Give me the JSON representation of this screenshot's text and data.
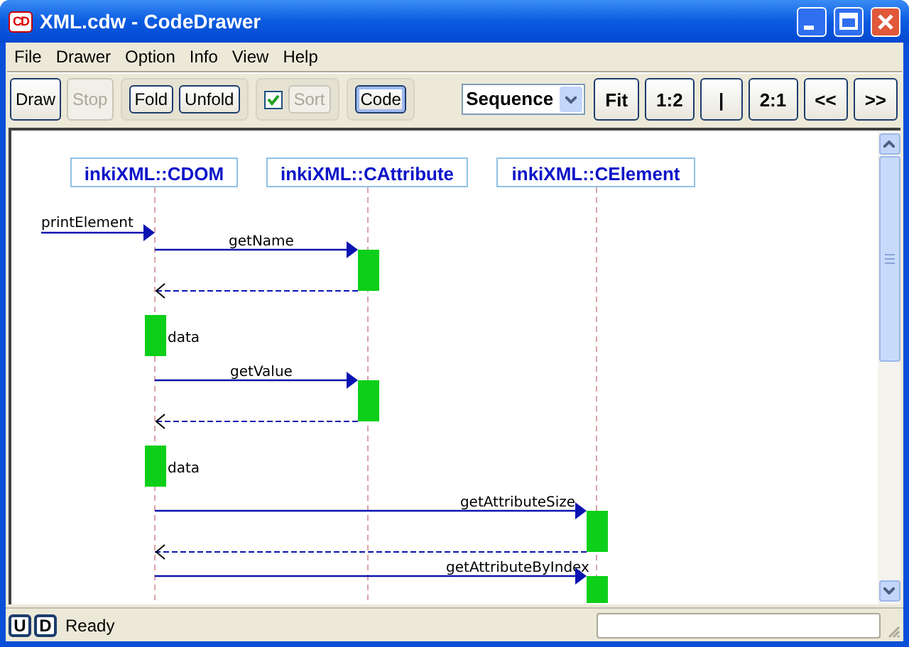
{
  "window": {
    "title": "XML.cdw - CodeDrawer",
    "icon_text": "CD"
  },
  "menu": [
    "File",
    "Drawer",
    "Option",
    "Info",
    "View",
    "Help"
  ],
  "toolbar": [
    [
      {
        "kind": "button",
        "label": "Draw",
        "disabled": false,
        "pressed": false
      },
      {
        "kind": "button",
        "label": "Stop",
        "disabled": true,
        "pressed": false
      }
    ],
    [
      {
        "kind": "button",
        "label": "Fold",
        "disabled": false,
        "pressed": false
      },
      {
        "kind": "button",
        "label": "Unfold",
        "disabled": false,
        "pressed": false
      }
    ],
    [
      {
        "kind": "checkbox",
        "checked": true
      },
      {
        "kind": "button",
        "label": "Sort",
        "disabled": true,
        "pressed": false
      }
    ],
    [
      {
        "kind": "button",
        "label": "Code",
        "disabled": false,
        "pressed": true
      }
    ],
    [
      {
        "kind": "dropdown",
        "value": "Sequence"
      },
      {
        "kind": "button",
        "label": "Fit",
        "disabled": false,
        "pressed": false
      },
      {
        "kind": "button",
        "label": "1:2",
        "disabled": false,
        "pressed": false
      },
      {
        "kind": "button",
        "label": "|",
        "disabled": false,
        "pressed": false
      },
      {
        "kind": "button",
        "label": "2:1",
        "disabled": false,
        "pressed": false
      },
      {
        "kind": "button",
        "label": "<<",
        "disabled": false,
        "pressed": false
      },
      {
        "kind": "button",
        "label": ">>",
        "disabled": false,
        "pressed": false
      }
    ]
  ],
  "diagram": {
    "lifelines": [
      "inkiXML::CDOM",
      "inkiXML::CAttribute",
      "inkiXML::CElement"
    ],
    "steps": [
      {
        "kind": "found",
        "label": "printElement"
      },
      {
        "kind": "call",
        "label": "getName"
      },
      {
        "kind": "return"
      },
      {
        "kind": "self",
        "label": "data"
      },
      {
        "kind": "call",
        "label": "getValue"
      },
      {
        "kind": "return"
      },
      {
        "kind": "self",
        "label": "data"
      },
      {
        "kind": "call",
        "label": "getAttributeSize"
      },
      {
        "kind": "return"
      },
      {
        "kind": "call",
        "label": "getAttributeByIndex"
      }
    ]
  },
  "status_bar": {
    "buttons": [
      "U",
      "D"
    ],
    "text": "Ready"
  }
}
